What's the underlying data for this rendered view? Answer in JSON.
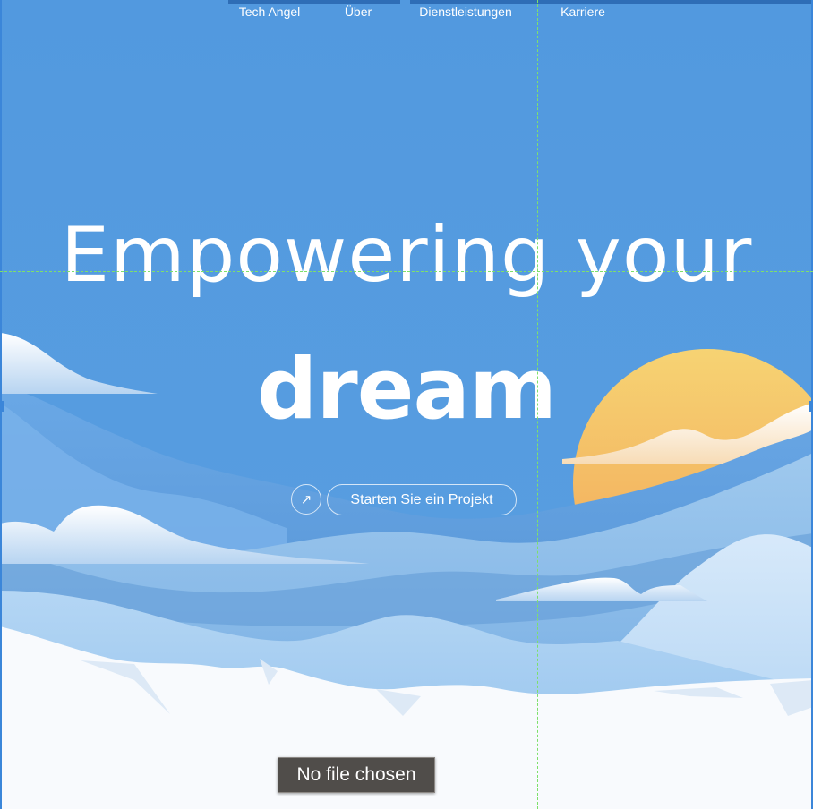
{
  "nav": {
    "items": [
      {
        "label": "Tech Angel"
      },
      {
        "label": "Über"
      },
      {
        "label": "Dienstleistungen"
      },
      {
        "label": "Karriere"
      }
    ]
  },
  "hero": {
    "title_line1": "Empowering your",
    "title_line2": "dream",
    "cta_icon": "↗",
    "cta_label": "Starten Sie ein Projekt"
  },
  "file_input": {
    "tooltip": "No file chosen"
  },
  "colors": {
    "sky": "#5299df",
    "sun_top": "#f6d373",
    "sun_bottom": "#f2a356",
    "guide": "#7ee06a",
    "snow": "#f8fafd"
  }
}
